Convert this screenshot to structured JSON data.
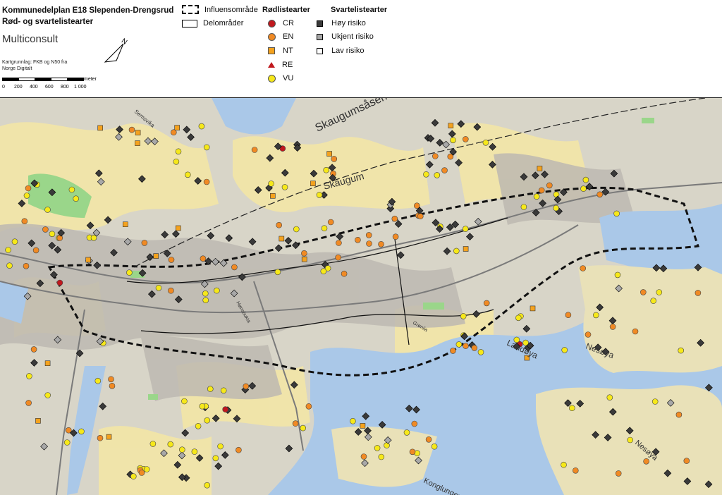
{
  "header": {
    "title_line1": "Kommunedelplan E18 Slependen-Drengsrud",
    "title_line2": "Rød- og svartelistearter",
    "company": "Multiconsult",
    "source_line1": "Kartgrunnlag: FKB og N50 fra",
    "source_line2": "Norge Digitalt",
    "scale_unit": "meter",
    "scale_ticks": [
      "0",
      "200",
      "400",
      "600",
      "800",
      "1 000"
    ]
  },
  "legend": {
    "areas": [
      {
        "label": "Influensområde",
        "symbol": "dashed-rect-icon"
      },
      {
        "label": "Delområder",
        "symbol": "rect-outline-icon"
      }
    ],
    "redlist_title": "Rødlistearter",
    "redlist": [
      {
        "code": "CR",
        "color": "#c0181d",
        "symbol": "circle-icon"
      },
      {
        "code": "EN",
        "color": "#f08a24",
        "symbol": "circle-icon"
      },
      {
        "code": "NT",
        "color": "#f4a21e",
        "symbol": "square-icon"
      },
      {
        "code": "RE",
        "color": "#c0181d",
        "symbol": "triangle-icon"
      },
      {
        "code": "VU",
        "color": "#f6e81a",
        "symbol": "circle-icon"
      }
    ],
    "blacklist_title": "Svartelistearter",
    "blacklist": [
      {
        "label": "Høy risiko",
        "color": "#3a3a3a",
        "symbol": "square-icon"
      },
      {
        "label": "Ukjent risiko",
        "color": "#a8a8a8",
        "symbol": "square-icon"
      },
      {
        "label": "Lav risiko",
        "color": "#ffffff",
        "symbol": "square-icon"
      }
    ]
  },
  "map_labels": [
    {
      "text": "Skaugumsåsen"
    },
    {
      "text": "Skaugum"
    },
    {
      "text": "Landøya"
    },
    {
      "text": "Nesøya"
    },
    {
      "text": "Semsvika"
    },
    {
      "text": "Grønlia"
    },
    {
      "text": "Konglungen"
    },
    {
      "text": "Nesøya"
    },
    {
      "text": "Hønsbukta"
    }
  ]
}
